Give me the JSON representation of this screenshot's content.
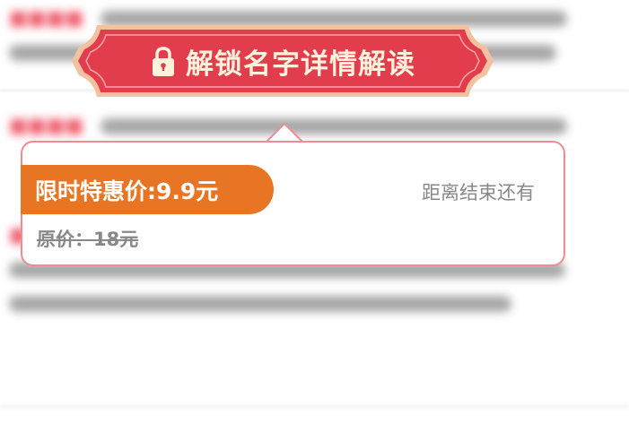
{
  "unlock_banner": {
    "label": "解锁名字详情解读",
    "icon": "lock-icon",
    "colors": {
      "fill": "#e23d4d",
      "border": "#f2c2a0",
      "text": "#fff2dc"
    }
  },
  "popup": {
    "sale_price_label": "限时特惠价:9.9元",
    "countdown_label": "距离结束还有",
    "original_price_label": "原价：18元",
    "colors": {
      "tag": "#e87524",
      "border": "#ec8d93",
      "muted_text": "#888888"
    }
  }
}
